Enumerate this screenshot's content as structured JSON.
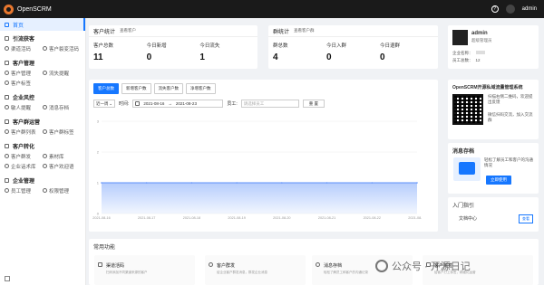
{
  "app": {
    "title": "OpenSCRM",
    "user": "admin"
  },
  "sidebar": {
    "home": "首页",
    "groups": [
      {
        "title": "引流获客",
        "items": [
          "渠道活码",
          "客户裂变活码"
        ]
      },
      {
        "title": "客户管理",
        "items": [
          "客户管理",
          "流失提醒",
          "客户标签"
        ]
      },
      {
        "title": "企业风控",
        "items": [
          "敏人提醒",
          "消息存档"
        ]
      },
      {
        "title": "客户群运营",
        "items": [
          "客户群列表",
          "客户群标签"
        ]
      },
      {
        "title": "客户转化",
        "items": [
          "客户群发",
          "素材库",
          "企业话术库",
          "客户欢迎语"
        ]
      },
      {
        "title": "企业管理",
        "items": [
          "员工管理",
          "权限管理"
        ]
      }
    ]
  },
  "customer_stats": {
    "title": "客户统计",
    "link": "查看客户",
    "items": [
      {
        "label": "客户总数",
        "value": "11"
      },
      {
        "label": "今日新增",
        "value": "0"
      },
      {
        "label": "今日流失",
        "value": "1"
      }
    ]
  },
  "group_stats": {
    "title": "群统计",
    "link": "查看客户群",
    "items": [
      {
        "label": "群总数",
        "value": "4"
      },
      {
        "label": "今日入群",
        "value": "0"
      },
      {
        "label": "今日退群",
        "value": "0"
      }
    ]
  },
  "profile": {
    "name": "admin",
    "role": "超级管理员",
    "company_label": "企业名称：",
    "staff_label": "员工总数：",
    "staff_value": "12"
  },
  "chart_panel": {
    "tabs": [
      "客户总数",
      "新增客户数",
      "流失客户数",
      "净增客户数"
    ],
    "period": "近一周",
    "time_label": "时间:",
    "date_from": "2021-08-16",
    "date_sep": "→",
    "date_to": "2021-08-23",
    "staff_label": "员工:",
    "staff_placeholder": "请选择员工",
    "reset": "重 置"
  },
  "chart_data": {
    "type": "area",
    "x": [
      "2021-08-16",
      "2021-08-17",
      "2021-08-18",
      "2021-08-19",
      "2021-08-20",
      "2021-08-21",
      "2021-08-22",
      "2021-08-23"
    ],
    "series": [
      {
        "values": [
          1,
          1,
          1,
          1,
          1,
          1,
          1,
          1
        ]
      }
    ],
    "yticks": [
      "0",
      "1",
      "2",
      "3"
    ],
    "ylim": [
      0,
      3
    ],
    "color": "#5b8ff9"
  },
  "promo": {
    "title": "OpenSCRM开源私域流量管理系统",
    "desc1": "扫描右侧二维码，欢迎提出反馈",
    "desc2": "微信扫码交流，加入交流群"
  },
  "archive": {
    "title": "消息存档",
    "desc": "轻松了解员工和客户的沟通情况",
    "button": "立即使用"
  },
  "guide": {
    "title": "入门指引",
    "item": "文档中心",
    "badge": "查看"
  },
  "functions": {
    "title": "常用功能",
    "items": [
      {
        "title": "渠道活码",
        "desc": "扫码添加不同渠道来源的客户"
      },
      {
        "title": "客户群发",
        "desc": "给企业客户群发消息，群发企业消息"
      },
      {
        "title": "消息存档",
        "desc": "轻松了解员工和客户的沟通记录"
      },
      {
        "title": "客户标签",
        "desc": "给客户打上标签，精细化运营"
      }
    ]
  },
  "watermark": "公众号 · 开源日记"
}
